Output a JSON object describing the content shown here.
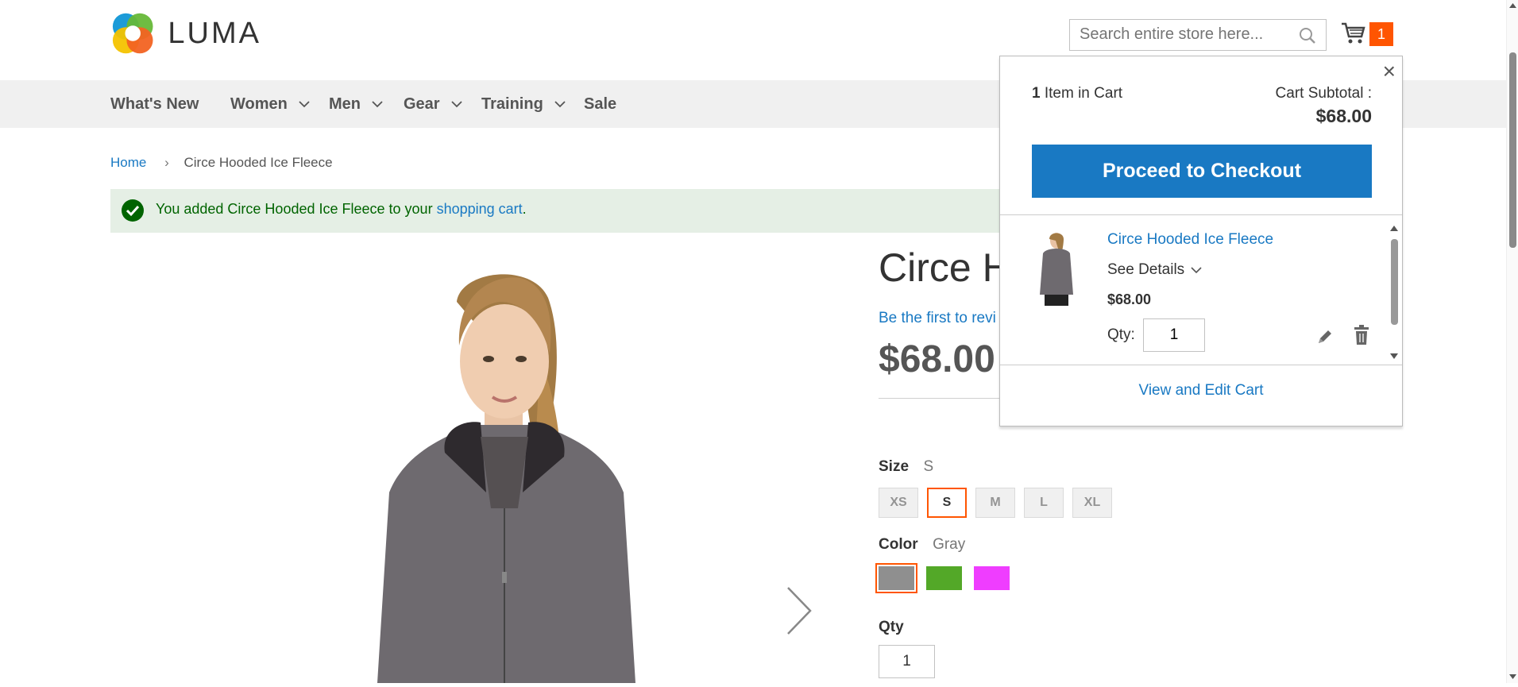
{
  "header": {
    "logo_text": "LUMA",
    "search_placeholder": "Search entire store here...",
    "cart_count": "1"
  },
  "nav": {
    "items": [
      {
        "label": "What's New",
        "has_dropdown": false
      },
      {
        "label": "Women",
        "has_dropdown": true
      },
      {
        "label": "Men",
        "has_dropdown": true
      },
      {
        "label": "Gear",
        "has_dropdown": true
      },
      {
        "label": "Training",
        "has_dropdown": true
      },
      {
        "label": "Sale",
        "has_dropdown": false
      }
    ]
  },
  "breadcrumb": {
    "home": "Home",
    "separator": "›",
    "current": "Circe Hooded Ice Fleece"
  },
  "message": {
    "prefix": "You added Circe Hooded Ice Fleece to your ",
    "link": "shopping cart",
    "suffix": "."
  },
  "product": {
    "title": "Circe H",
    "review_link": "Be the first to revi",
    "price": "$68.00",
    "size_label": "Size",
    "size_value": "S",
    "sizes": [
      "XS",
      "S",
      "M",
      "L",
      "XL"
    ],
    "selected_size": "S",
    "color_label": "Color",
    "color_value": "Gray",
    "swatches": [
      {
        "name": "Gray",
        "hex": "#8f8f8f",
        "selected": true
      },
      {
        "name": "Green",
        "hex": "#53a828",
        "selected": false
      },
      {
        "name": "Purple",
        "hex": "#ef3dff",
        "selected": false
      }
    ],
    "qty_label": "Qty",
    "qty_value": "1"
  },
  "minicart": {
    "item_count": "1",
    "item_count_label": " Item in Cart",
    "subtotal_label": "Cart Subtotal :",
    "subtotal_value": "$68.00",
    "checkout_label": "Proceed to Checkout",
    "item": {
      "name": "Circe Hooded Ice Fleece",
      "details_label": "See Details",
      "price": "$68.00",
      "qty_label": "Qty:",
      "qty_value": "1"
    },
    "view_cart_label": "View and Edit Cart"
  },
  "colors": {
    "accent": "#1979c3",
    "cart_badge": "#ff5501",
    "success_bg": "#e5efe5",
    "success_text": "#006400"
  }
}
